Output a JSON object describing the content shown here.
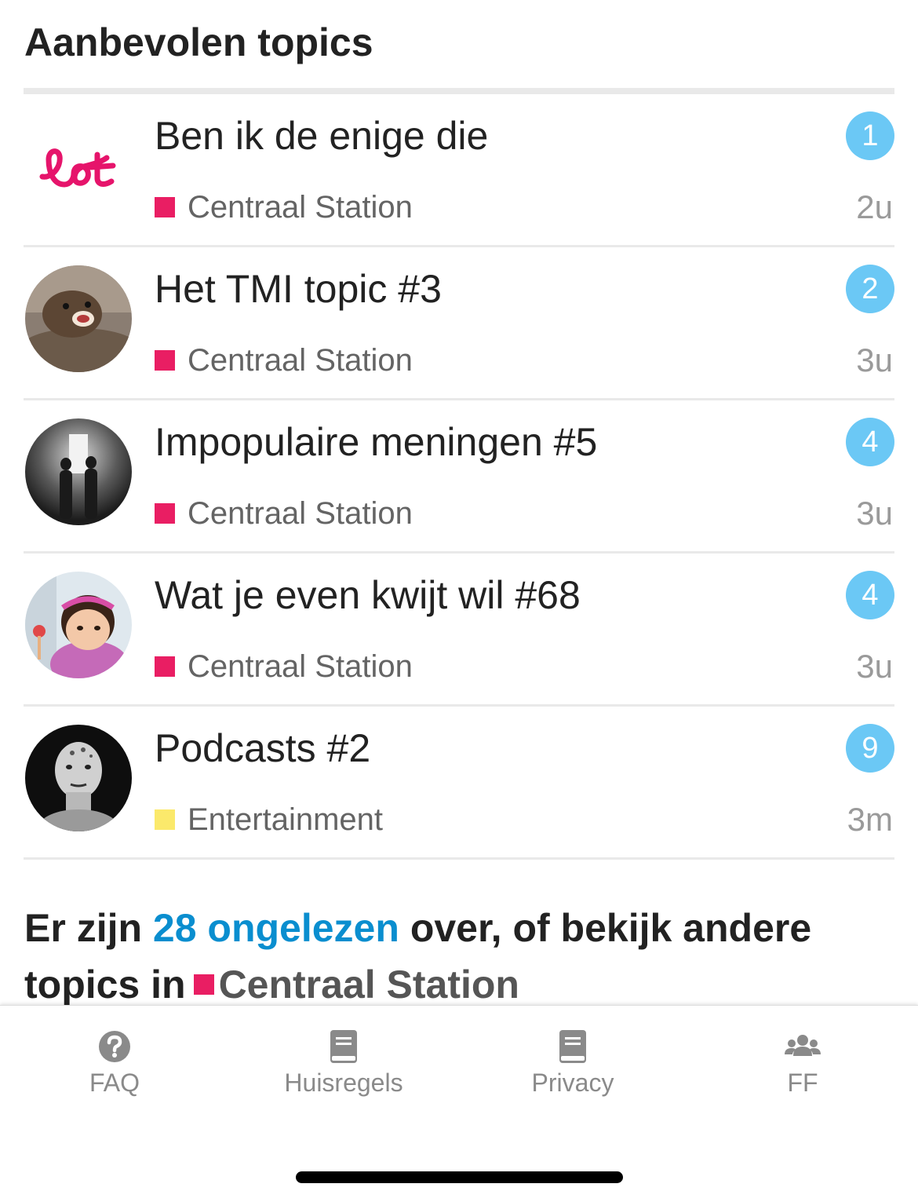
{
  "section_title": "Aanbevolen topics",
  "topics": [
    {
      "title": "Ben ik de enige die",
      "category": "Centraal Station",
      "category_color": "#e91e63",
      "unread": "1",
      "age": "2u",
      "avatar": "lot-logo"
    },
    {
      "title": "Het TMI topic #3",
      "category": "Centraal Station",
      "category_color": "#e91e63",
      "unread": "2",
      "age": "3u",
      "avatar": "otter-photo"
    },
    {
      "title": "Impopulaire meningen #5",
      "category": "Centraal Station",
      "category_color": "#e91e63",
      "unread": "4",
      "age": "3u",
      "avatar": "silhouettes-photo"
    },
    {
      "title": "Wat je even kwijt wil #68",
      "category": "Centraal Station",
      "category_color": "#e91e63",
      "unread": "4",
      "age": "3u",
      "avatar": "cartoon-girl-photo"
    },
    {
      "title": "Podcasts #2",
      "category": "Entertainment",
      "category_color": "#fbe96b",
      "unread": "9",
      "age": "3m",
      "avatar": "tattooed-man-photo"
    }
  ],
  "footer": {
    "prefix": "Er zijn ",
    "link": "28 ongelezen",
    "middle": " over, of bekijk andere topics in",
    "category": "Centraal Station",
    "category_color": "#e91e63"
  },
  "nav": {
    "faq": "FAQ",
    "huisregels": "Huisregels",
    "privacy": "Privacy",
    "ff": "FF"
  },
  "colors": {
    "badge": "#6bc8f5",
    "link": "#0a8ecf",
    "lot_brand": "#e6146b"
  }
}
